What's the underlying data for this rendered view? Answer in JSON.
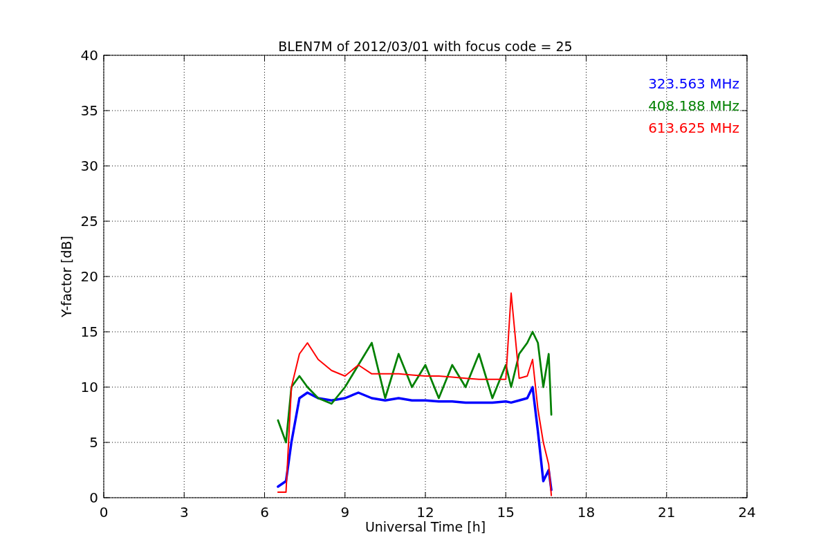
{
  "chart_data": {
    "type": "line",
    "title": "BLEN7M of 2012/03/01 with focus code = 25",
    "xlabel": "Universal Time [h]",
    "ylabel": "Y-factor [dB]",
    "x": [
      6.5,
      6.8,
      7.0,
      7.3,
      7.6,
      8,
      8.5,
      9,
      9.5,
      10,
      10.5,
      11,
      11.5,
      12,
      12.5,
      13,
      13.5,
      14,
      14.5,
      15,
      15.2,
      15.5,
      15.8,
      16,
      16.2,
      16.4,
      16.6,
      16.7
    ],
    "series": [
      {
        "name": "323.563 MHz",
        "color": "#0000ff",
        "values": [
          1,
          1.5,
          5,
          9,
          9.5,
          9,
          8.8,
          9,
          9.5,
          9,
          8.8,
          9,
          8.8,
          8.8,
          8.7,
          8.7,
          8.6,
          8.6,
          8.6,
          8.7,
          8.6,
          8.8,
          9,
          10,
          6,
          1.5,
          2.5,
          0.7
        ]
      },
      {
        "name": "408.188 MHz",
        "color": "#008000",
        "values": [
          7,
          5,
          10,
          11,
          10,
          9,
          8.5,
          10,
          12,
          14,
          9,
          13,
          10,
          12,
          9,
          12,
          10,
          13,
          9,
          12,
          10,
          13,
          14,
          15,
          14,
          10,
          13,
          7.5
        ]
      },
      {
        "name": "613.625 MHz",
        "color": "#ff0000",
        "values": [
          0.5,
          0.5,
          10,
          13,
          14,
          12.5,
          11.5,
          11,
          12,
          11.2,
          11.2,
          11.2,
          11.1,
          11,
          11,
          10.9,
          10.8,
          10.7,
          10.7,
          10.7,
          18.5,
          10.8,
          11,
          12.5,
          8,
          5,
          3,
          0.2
        ]
      }
    ],
    "xlim": [
      0,
      24
    ],
    "ylim": [
      0,
      40
    ],
    "xticks": [
      0,
      3,
      6,
      9,
      12,
      15,
      18,
      21,
      24
    ],
    "yticks": [
      0,
      5,
      10,
      15,
      20,
      25,
      30,
      35,
      40
    ],
    "grid": true
  }
}
